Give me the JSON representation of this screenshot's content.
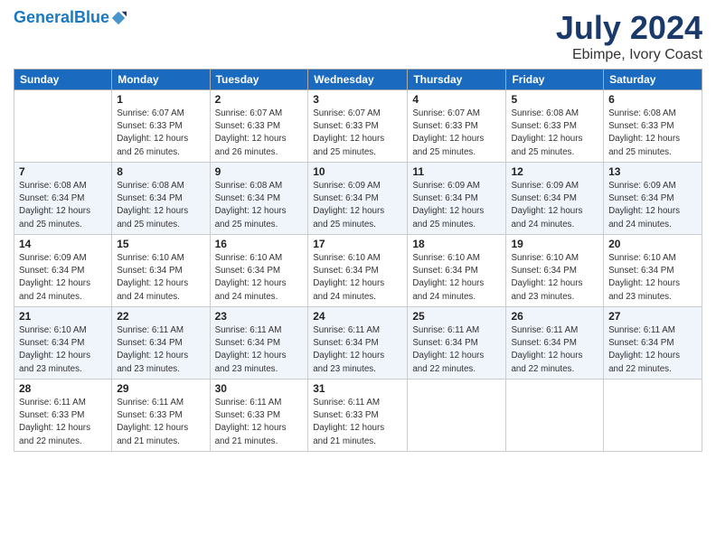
{
  "header": {
    "logo_line1": "General",
    "logo_line2": "Blue",
    "month_year": "July 2024",
    "location": "Ebimpe, Ivory Coast"
  },
  "days_of_week": [
    "Sunday",
    "Monday",
    "Tuesday",
    "Wednesday",
    "Thursday",
    "Friday",
    "Saturday"
  ],
  "weeks": [
    [
      {
        "day": "",
        "info": ""
      },
      {
        "day": "1",
        "info": "Sunrise: 6:07 AM\nSunset: 6:33 PM\nDaylight: 12 hours\nand 26 minutes."
      },
      {
        "day": "2",
        "info": "Sunrise: 6:07 AM\nSunset: 6:33 PM\nDaylight: 12 hours\nand 26 minutes."
      },
      {
        "day": "3",
        "info": "Sunrise: 6:07 AM\nSunset: 6:33 PM\nDaylight: 12 hours\nand 25 minutes."
      },
      {
        "day": "4",
        "info": "Sunrise: 6:07 AM\nSunset: 6:33 PM\nDaylight: 12 hours\nand 25 minutes."
      },
      {
        "day": "5",
        "info": "Sunrise: 6:08 AM\nSunset: 6:33 PM\nDaylight: 12 hours\nand 25 minutes."
      },
      {
        "day": "6",
        "info": "Sunrise: 6:08 AM\nSunset: 6:33 PM\nDaylight: 12 hours\nand 25 minutes."
      }
    ],
    [
      {
        "day": "7",
        "info": "Sunrise: 6:08 AM\nSunset: 6:34 PM\nDaylight: 12 hours\nand 25 minutes."
      },
      {
        "day": "8",
        "info": "Sunrise: 6:08 AM\nSunset: 6:34 PM\nDaylight: 12 hours\nand 25 minutes."
      },
      {
        "day": "9",
        "info": "Sunrise: 6:08 AM\nSunset: 6:34 PM\nDaylight: 12 hours\nand 25 minutes."
      },
      {
        "day": "10",
        "info": "Sunrise: 6:09 AM\nSunset: 6:34 PM\nDaylight: 12 hours\nand 25 minutes."
      },
      {
        "day": "11",
        "info": "Sunrise: 6:09 AM\nSunset: 6:34 PM\nDaylight: 12 hours\nand 25 minutes."
      },
      {
        "day": "12",
        "info": "Sunrise: 6:09 AM\nSunset: 6:34 PM\nDaylight: 12 hours\nand 24 minutes."
      },
      {
        "day": "13",
        "info": "Sunrise: 6:09 AM\nSunset: 6:34 PM\nDaylight: 12 hours\nand 24 minutes."
      }
    ],
    [
      {
        "day": "14",
        "info": "Sunrise: 6:09 AM\nSunset: 6:34 PM\nDaylight: 12 hours\nand 24 minutes."
      },
      {
        "day": "15",
        "info": "Sunrise: 6:10 AM\nSunset: 6:34 PM\nDaylight: 12 hours\nand 24 minutes."
      },
      {
        "day": "16",
        "info": "Sunrise: 6:10 AM\nSunset: 6:34 PM\nDaylight: 12 hours\nand 24 minutes."
      },
      {
        "day": "17",
        "info": "Sunrise: 6:10 AM\nSunset: 6:34 PM\nDaylight: 12 hours\nand 24 minutes."
      },
      {
        "day": "18",
        "info": "Sunrise: 6:10 AM\nSunset: 6:34 PM\nDaylight: 12 hours\nand 24 minutes."
      },
      {
        "day": "19",
        "info": "Sunrise: 6:10 AM\nSunset: 6:34 PM\nDaylight: 12 hours\nand 23 minutes."
      },
      {
        "day": "20",
        "info": "Sunrise: 6:10 AM\nSunset: 6:34 PM\nDaylight: 12 hours\nand 23 minutes."
      }
    ],
    [
      {
        "day": "21",
        "info": "Sunrise: 6:10 AM\nSunset: 6:34 PM\nDaylight: 12 hours\nand 23 minutes."
      },
      {
        "day": "22",
        "info": "Sunrise: 6:11 AM\nSunset: 6:34 PM\nDaylight: 12 hours\nand 23 minutes."
      },
      {
        "day": "23",
        "info": "Sunrise: 6:11 AM\nSunset: 6:34 PM\nDaylight: 12 hours\nand 23 minutes."
      },
      {
        "day": "24",
        "info": "Sunrise: 6:11 AM\nSunset: 6:34 PM\nDaylight: 12 hours\nand 23 minutes."
      },
      {
        "day": "25",
        "info": "Sunrise: 6:11 AM\nSunset: 6:34 PM\nDaylight: 12 hours\nand 22 minutes."
      },
      {
        "day": "26",
        "info": "Sunrise: 6:11 AM\nSunset: 6:34 PM\nDaylight: 12 hours\nand 22 minutes."
      },
      {
        "day": "27",
        "info": "Sunrise: 6:11 AM\nSunset: 6:34 PM\nDaylight: 12 hours\nand 22 minutes."
      }
    ],
    [
      {
        "day": "28",
        "info": "Sunrise: 6:11 AM\nSunset: 6:33 PM\nDaylight: 12 hours\nand 22 minutes."
      },
      {
        "day": "29",
        "info": "Sunrise: 6:11 AM\nSunset: 6:33 PM\nDaylight: 12 hours\nand 21 minutes."
      },
      {
        "day": "30",
        "info": "Sunrise: 6:11 AM\nSunset: 6:33 PM\nDaylight: 12 hours\nand 21 minutes."
      },
      {
        "day": "31",
        "info": "Sunrise: 6:11 AM\nSunset: 6:33 PM\nDaylight: 12 hours\nand 21 minutes."
      },
      {
        "day": "",
        "info": ""
      },
      {
        "day": "",
        "info": ""
      },
      {
        "day": "",
        "info": ""
      }
    ]
  ]
}
